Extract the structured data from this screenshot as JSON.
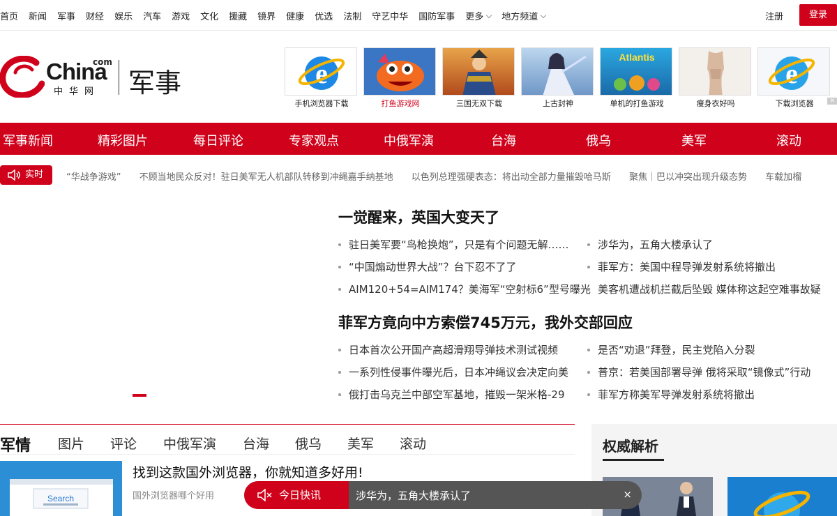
{
  "topnav": {
    "links": [
      "首页",
      "新闻",
      "军事",
      "财经",
      "娱乐",
      "汽车",
      "游戏",
      "文化",
      "援藏",
      "镜界",
      "健康",
      "优选",
      "法制",
      "守艺中华",
      "国防军事",
      "更多",
      "地方频道"
    ],
    "register": "注册",
    "login": "登录"
  },
  "logo": {
    "com": "com",
    "china": "China",
    "zh": "中华网",
    "channel": "军事"
  },
  "ads": [
    {
      "caption": "手机浏览器下载",
      "icon": "browser-e-icon"
    },
    {
      "caption": "打鱼游戏网",
      "icon": "fish-game-icon"
    },
    {
      "caption": "三国无双下载",
      "icon": "warrior-game-icon"
    },
    {
      "caption": "上古封神",
      "icon": "fantasy-game-icon"
    },
    {
      "caption": "单机的打鱼游戏",
      "icon": "atlantis-game-icon"
    },
    {
      "caption": "瘦身衣好吗",
      "icon": "shapewear-icon"
    },
    {
      "caption": "下载浏览器",
      "icon": "browser-e-icon"
    }
  ],
  "rednav": [
    "军事新闻",
    "精彩图片",
    "每日评论",
    "专家观点",
    "中俄军演",
    "台海",
    "俄乌",
    "美军",
    "滚动"
  ],
  "ticker": {
    "badge": "实时",
    "items": [
      "“华战争游戏”",
      "不顾当地民众反对！驻日美军无人机部队转移到冲绳嘉手纳基地",
      "以色列总理强硬表态：将出动全部力量摧毁哈马斯",
      "聚焦｜巴以冲突出现升级态势",
      "车载加榴"
    ]
  },
  "groups": [
    {
      "headline": "一觉醒来，英国大变天了",
      "left": [
        "驻日美军要“鸟枪换炮”，只是有个问题无解……",
        "“中国煽动世界大战”？台下忍不了了",
        "AIM120+54=AIM174？美海军“空射标6”型号曝光"
      ],
      "right": [
        "涉华为，五角大楼承认了",
        "菲军方：美国中程导弹发射系统将撤出",
        "美客机遭战机拦截后坠毁 媒体称这起空难事故疑"
      ]
    },
    {
      "headline": "菲军方竟向中方索偿745万元，我外交部回应",
      "left": [
        "日本首次公开国产高超滑翔导弹技术测试视频",
        "一系列性侵事件曝光后，日本冲绳议会决定向美",
        "俄打击乌克兰中部空军基地，摧毁一架米格-29"
      ],
      "right": [
        "是否“劝退”拜登，民主党陷入分裂",
        "普京：若美国部署导弹 俄将采取“镜像式”行动",
        "菲军方称美军导弹发射系统将撤出"
      ]
    }
  ],
  "tabs": [
    "军情",
    "图片",
    "评论",
    "中俄军演",
    "台海",
    "俄乌",
    "美军",
    "滚动"
  ],
  "card": {
    "title": "找到这款国外浏览器，你就知道多好用!",
    "sub": "国外浏览器哪个好用",
    "thumb_text": "Search"
  },
  "side": {
    "title": "权威解析"
  },
  "flash": {
    "label": "今日快讯",
    "text": "涉华为，五角大楼承认了",
    "close": "×"
  },
  "colors": {
    "brand_red": "#d0021b"
  }
}
